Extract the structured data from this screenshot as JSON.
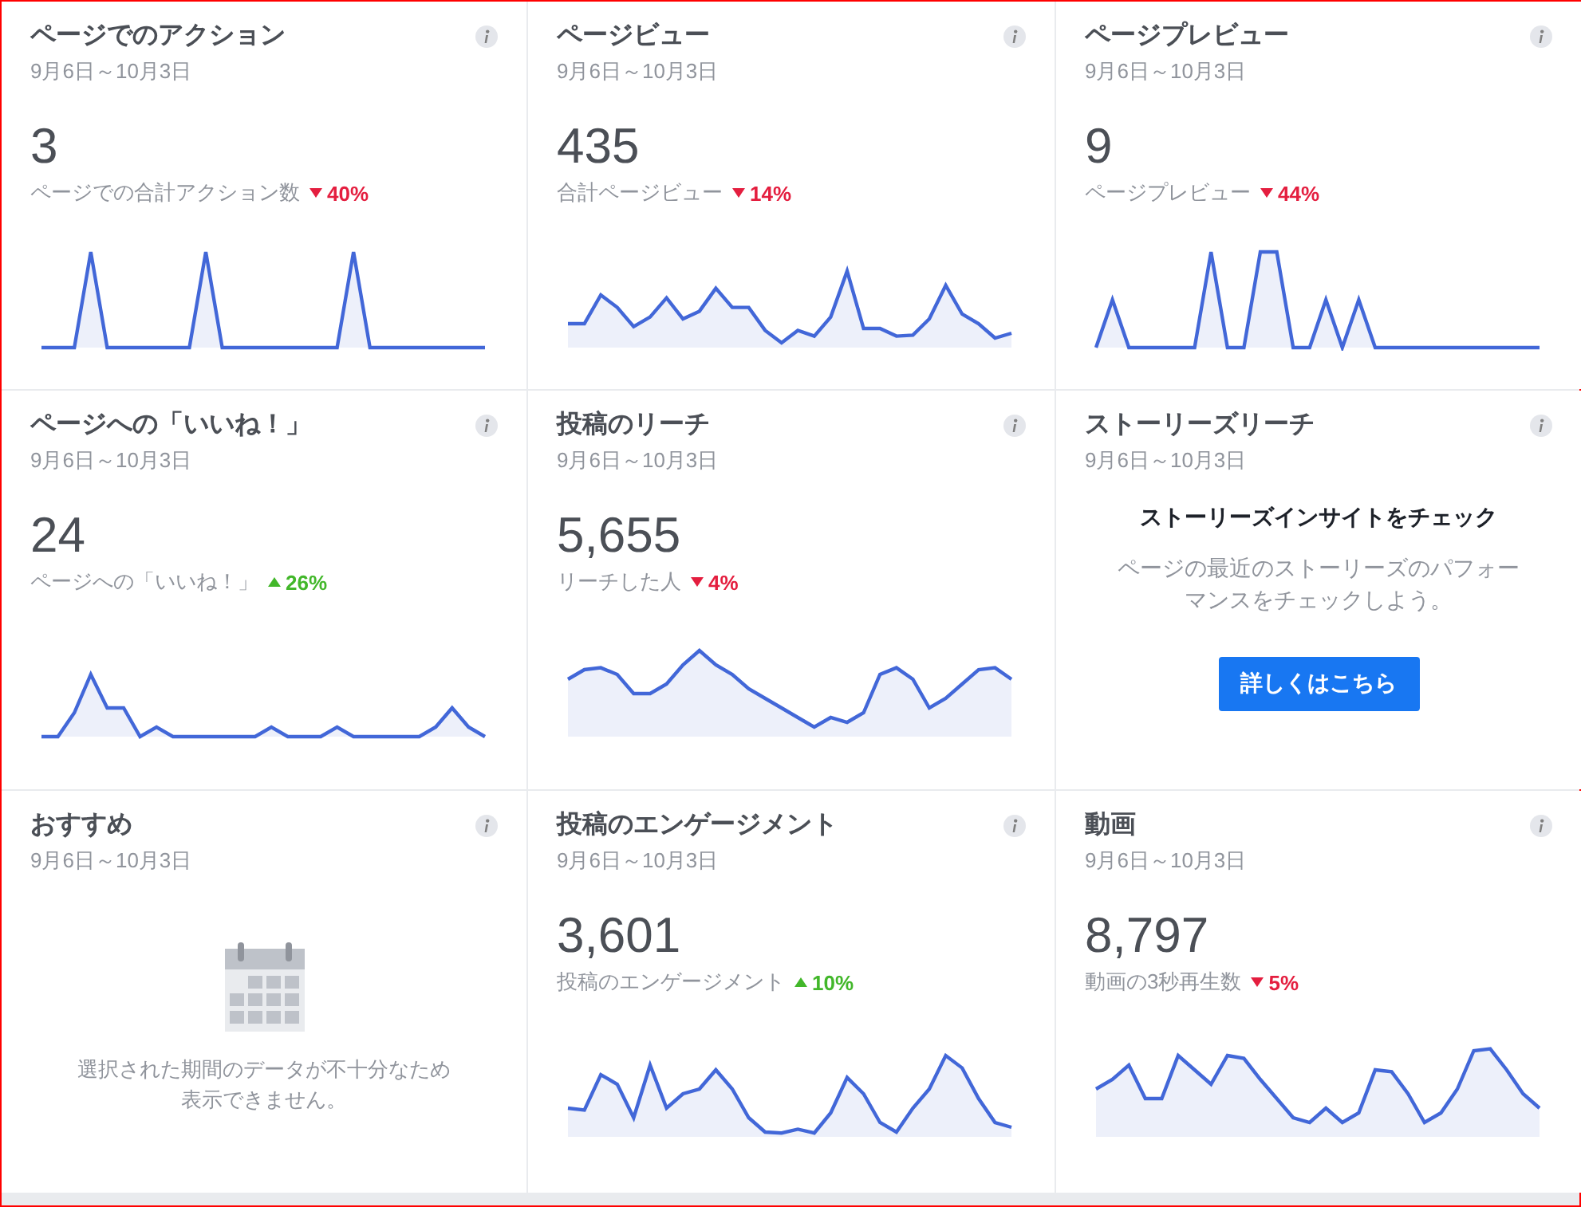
{
  "cards": [
    {
      "kind": "metric",
      "title": "ページでのアクション",
      "date": "9月6日～10月3日",
      "value": "3",
      "label": "ページでの合計アクション数",
      "increase": false,
      "change": "40%"
    },
    {
      "kind": "metric",
      "title": "ページビュー",
      "date": "9月6日～10月3日",
      "value": "435",
      "label": "合計ページビュー",
      "increase": false,
      "change": "14%"
    },
    {
      "kind": "metric",
      "title": "ページプレビュー",
      "date": "9月6日～10月3日",
      "value": "9",
      "label": "ページプレビュー",
      "increase": false,
      "change": "44%"
    },
    {
      "kind": "metric",
      "title": "ページへの「いいね！」",
      "date": "9月6日～10月3日",
      "value": "24",
      "label": "ページへの「いいね！」",
      "increase": true,
      "change": "26%"
    },
    {
      "kind": "metric",
      "title": "投稿のリーチ",
      "date": "9月6日～10月3日",
      "value": "5,655",
      "label": "リーチした人",
      "increase": false,
      "change": "4%"
    },
    {
      "kind": "stories",
      "title": "ストーリーズリーチ",
      "date": "9月6日～10月3日",
      "heading": "ストーリーズインサイトをチェック",
      "text": "ページの最近のストーリーズのパフォーマンスをチェックしよう。",
      "button": "詳しくはこちら"
    },
    {
      "kind": "empty",
      "title": "おすすめ",
      "date": "9月6日～10月3日",
      "message": "選択された期間のデータが不十分なため表示できません。"
    },
    {
      "kind": "metric",
      "title": "投稿のエンゲージメント",
      "date": "9月6日～10月3日",
      "value": "3,601",
      "label": "投稿のエンゲージメント",
      "increase": true,
      "change": "10%"
    },
    {
      "kind": "metric",
      "title": "動画",
      "date": "9月6日～10月3日",
      "value": "8,797",
      "label": "動画の3秒再生数",
      "increase": false,
      "change": "5%"
    }
  ]
}
